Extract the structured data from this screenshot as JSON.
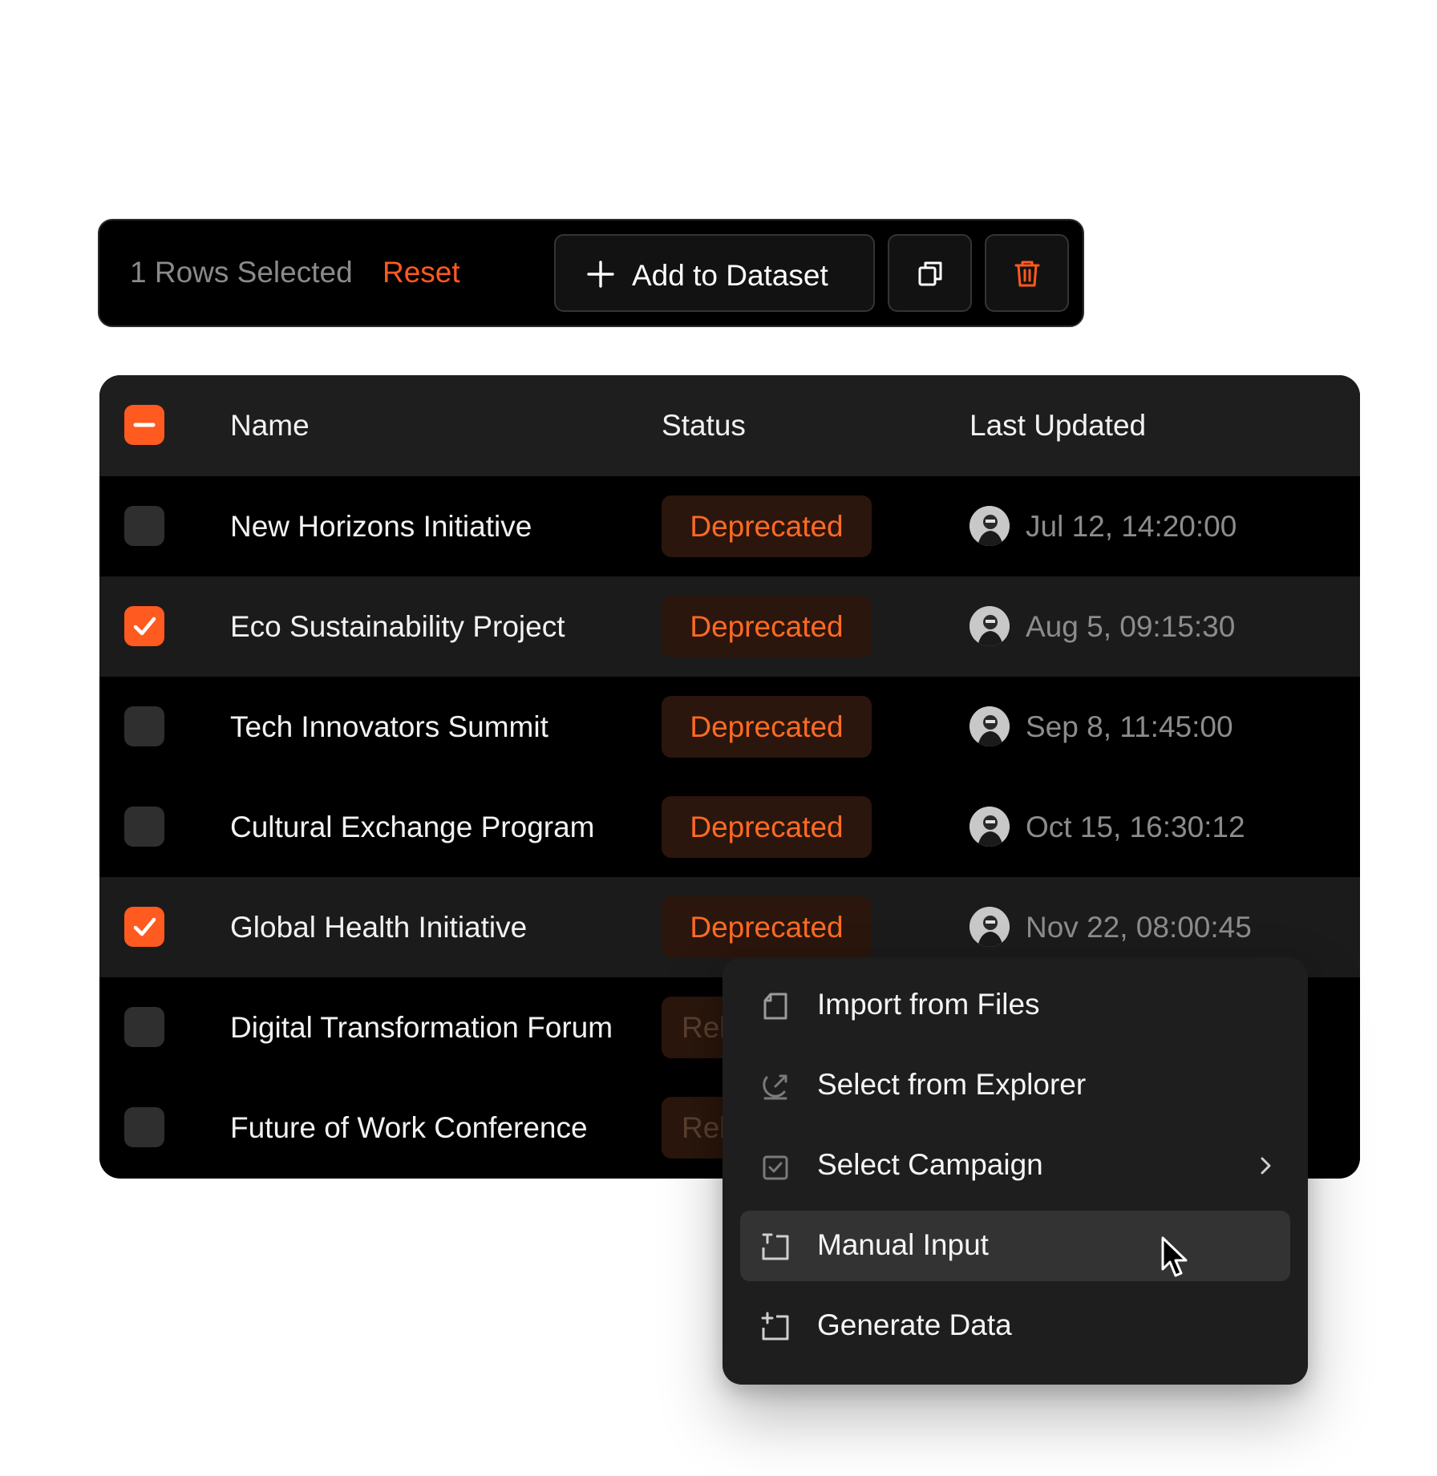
{
  "toolbar": {
    "selected_text": "1 Rows Selected",
    "reset_label": "Reset",
    "add_label": "Add to Dataset",
    "copy_icon": "copy-icon",
    "delete_icon": "trash-icon"
  },
  "table": {
    "columns": {
      "name": "Name",
      "status": "Status",
      "updated": "Last Updated"
    },
    "rows": [
      {
        "name": "New Horizons Initiative",
        "status": "Deprecated",
        "updated": "Jul 12, 14:20:00",
        "checked": false
      },
      {
        "name": "Eco Sustainability Project",
        "status": "Deprecated",
        "updated": "Aug 5, 09:15:30",
        "checked": true
      },
      {
        "name": "Tech Innovators Summit",
        "status": "Deprecated",
        "updated": "Sep 8, 11:45:00",
        "checked": false
      },
      {
        "name": "Cultural Exchange Program",
        "status": "Deprecated",
        "updated": "Oct 15, 16:30:12",
        "checked": false
      },
      {
        "name": "Global Health Initiative",
        "status": "Deprecated",
        "updated": "Nov 22, 08:00:45",
        "checked": true
      },
      {
        "name": "Digital Transformation Forum",
        "status": "Rel",
        "checked": false
      },
      {
        "name": "Future of Work Conference",
        "status": "Rel",
        "checked": false
      }
    ]
  },
  "menu": {
    "items": [
      {
        "label": "Import from Files",
        "icon": "file-icon"
      },
      {
        "label": "Select from Explorer",
        "icon": "explorer-icon"
      },
      {
        "label": "Select Campaign",
        "icon": "campaign-check-icon"
      },
      {
        "label": "Manual Input",
        "icon": "text-input-icon"
      },
      {
        "label": "Generate Data",
        "icon": "sparkle-frame-icon"
      }
    ]
  },
  "colors": {
    "accent": "#ff5a1f",
    "badge_bg": "#2a160c",
    "panel": "#000000",
    "header": "#1e1e1e"
  }
}
